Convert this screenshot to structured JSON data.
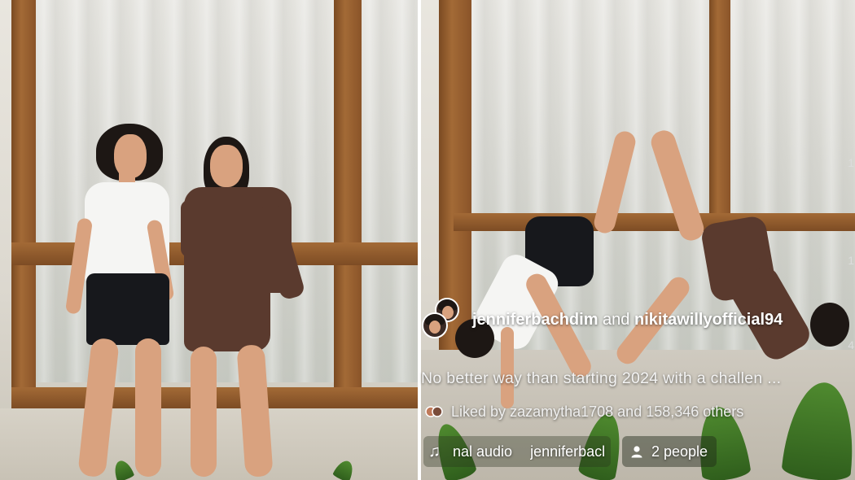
{
  "post": {
    "author_primary": "jenniferbachdim",
    "author_join": "and",
    "author_secondary": "nikitawillyofficial94",
    "caption": "No better way than starting 2024 with a challen ...",
    "likes_prefix": "Liked by",
    "likes_user": "zazamytha1708",
    "likes_suffix": "and 158,346 others",
    "audio_part_a": "nal audio",
    "audio_part_b": "jenniferbacl",
    "people_tag": "2 people"
  },
  "icons": {
    "audio": "music-note-icon",
    "people": "person-icon",
    "likes": "liked-by-avatars-icon"
  },
  "colors": {
    "overlay_text": "#ffffff",
    "frame_wood": "#a36a36",
    "curtain": "#d6d6d0"
  }
}
